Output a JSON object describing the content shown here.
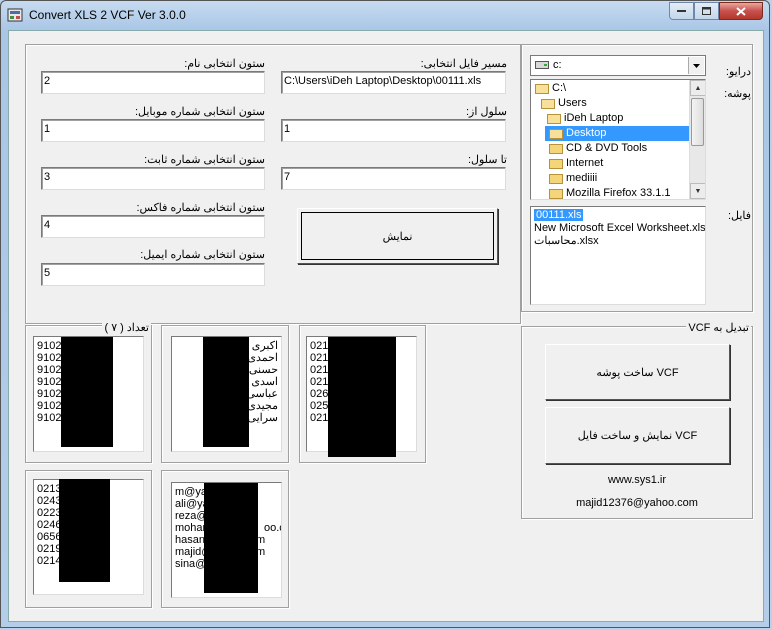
{
  "window": {
    "title": "Convert XLS 2 VCF Ver 3.0.0"
  },
  "form": {
    "path_label": "مسیر فایل انتخابی:",
    "path_value": "C:\\Users\\iDeh Laptop\\Desktop\\00111.xls",
    "name_col_label": "ستون  انتخابی نام:",
    "name_col_value": "2",
    "mobile_col_label": "ستون  انتخابی شماره موبایل:",
    "mobile_col_value": "1",
    "from_row_label": "سلول از:",
    "from_row_value": "1",
    "phone_col_label": "ستون  انتخابی شماره ثابت:",
    "phone_col_value": "3",
    "to_row_label": "تا سلول:",
    "to_row_value": "7",
    "fax_col_label": "ستون  انتخابی شماره فاکس:",
    "fax_col_value": "4",
    "email_col_label": "ستون  انتخابی شماره ایمیل:",
    "email_col_value": "5",
    "show_button": "نمایش"
  },
  "browser": {
    "drive_label": "درایو:",
    "drive_value": "c:",
    "folder_label": "پوشه:",
    "folders": [
      "C:\\",
      "Users",
      "iDeh Laptop",
      "Desktop",
      "CD & DVD Tools",
      "Internet",
      "mediiii",
      "Mozilla Firefox 33.1.1"
    ],
    "file_label": "فایل:",
    "files": [
      "00111.xls",
      "New Microsoft Excel Worksheet.xls",
      "محاسبات.xlsx"
    ]
  },
  "preview": {
    "count_label": "تعداد ( ۷ )",
    "mobile": [
      "9102",
      "9102",
      "9102",
      "9102",
      "9102",
      "9102",
      "9102"
    ],
    "names": [
      "اکبری",
      "احمدی",
      "حسنی",
      "اسدی",
      "عباسی",
      "مجیدی",
      "سرایی"
    ],
    "phone": [
      "021",
      "021",
      "021",
      "021",
      "026",
      "025",
      "021"
    ],
    "fax": [
      "0213",
      "0243",
      "0223",
      "0246",
      "0656",
      "0219",
      "0214"
    ],
    "email": [
      "m@ya",
      "ali@ya",
      "reza@",
      "mohan",
      "hasan",
      "majid@",
      "sina@"
    ],
    "email_tail": "oo.cc",
    "email_tail2": "m",
    "email_tail3": "m"
  },
  "convert": {
    "group_label": "تبدیل به VCF",
    "make_folder_button": "ساخت پوشه VCF",
    "show_make_button": "نمایش و ساخت فایل VCF",
    "website": "www.sys1.ir",
    "email": "majid12376@yahoo.com"
  }
}
